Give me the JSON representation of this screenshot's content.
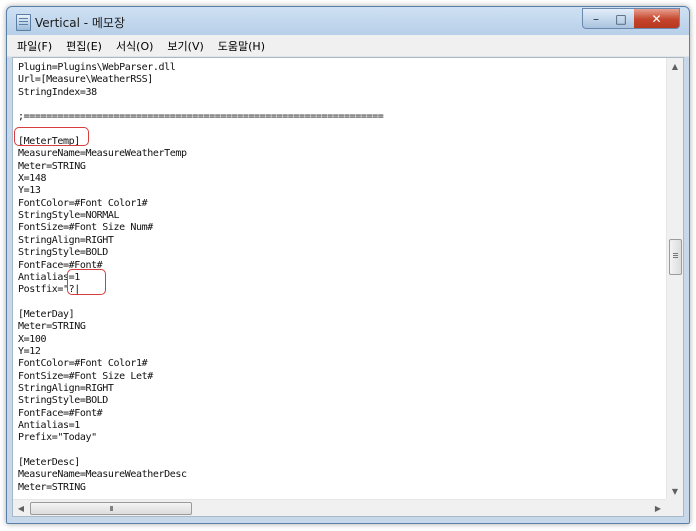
{
  "window": {
    "title": "Vertical - 메모장"
  },
  "menu": [
    "파일(F)",
    "편집(E)",
    "서식(O)",
    "보기(V)",
    "도움말(H)"
  ],
  "editor": {
    "text": "Plugin=Plugins\\WebParser.dll\nUrl=[Measure\\WeatherRSS]\nStringIndex=38\n\n;================================================================\n\n[MeterTemp]\nMeasureName=MeasureWeatherTemp\nMeter=STRING\nX=148\nY=13\nFontColor=#Font Color1#\nStringStyle=NORMAL\nFontSize=#Font Size Num#\nStringAlign=RIGHT\nStringStyle=BOLD\nFontFace=#Font#\nAntialias=1\nPostfix=\"?|\n\n[MeterDay]\nMeter=STRING\nX=100\nY=12\nFontColor=#Font Color1#\nFontSize=#Font Size Let#\nStringAlign=RIGHT\nStringStyle=BOLD\nFontFace=#Font#\nAntialias=1\nPrefix=\"Today\"\n\n[MeterDesc]\nMeasureName=MeasureWeatherDesc\nMeter=STRING\nX=100\nY=24"
  },
  "scrollbar": {
    "grip": "III"
  },
  "colors": {
    "highlight": "#d83c3c"
  }
}
